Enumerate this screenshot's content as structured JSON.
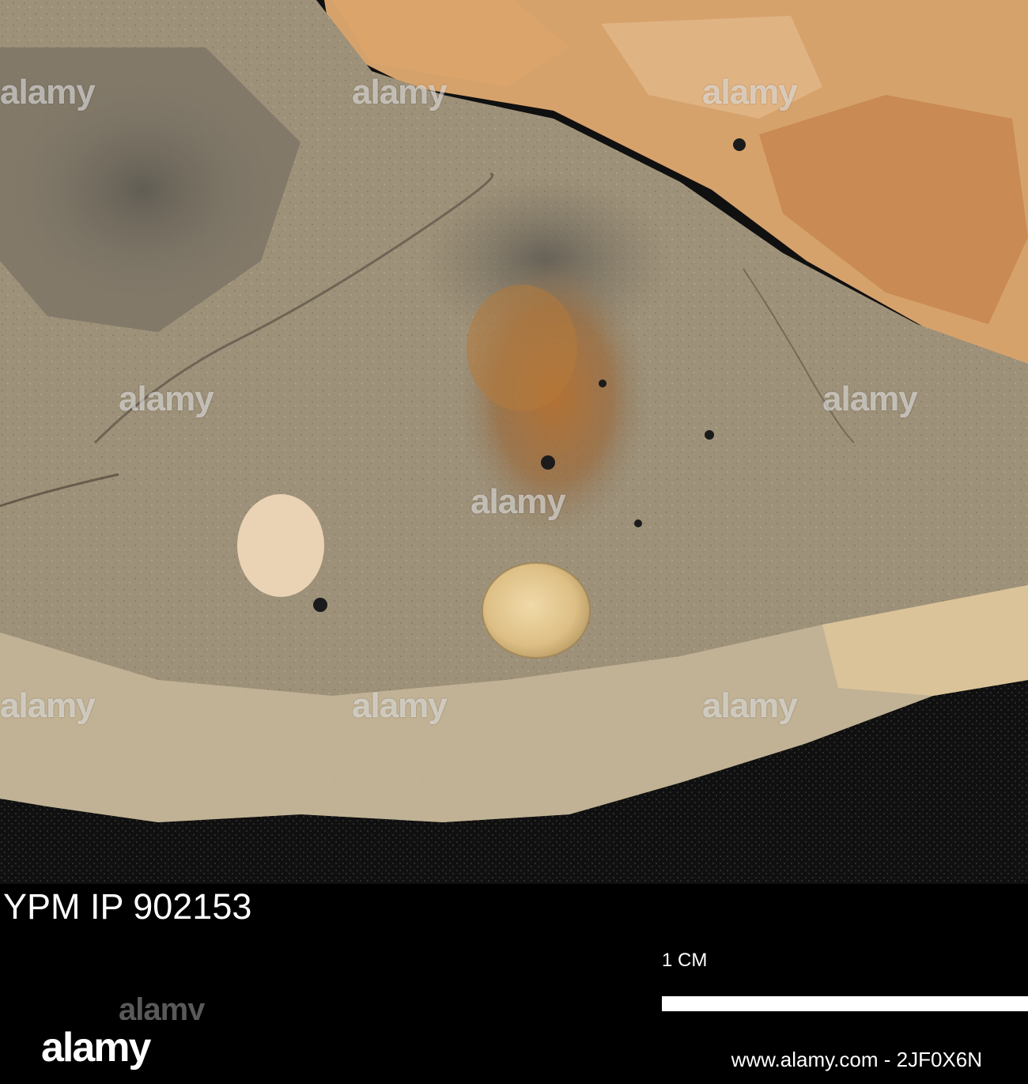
{
  "photo": {
    "subject": "fossil specimen on sediment rock",
    "colors": {
      "rock_gray": "#9c8f78",
      "rock_light": "#b8a98a",
      "orange_clast": "#d9a570",
      "stain_brown": "#a8692d",
      "shell_cream": "#e8cfa0",
      "dark_background": "#0e0e0e"
    }
  },
  "watermark": {
    "text": "alamy"
  },
  "caption": {
    "specimen_id": "YPM IP 902153",
    "scale_label": "1 CM"
  },
  "footer": {
    "logo_text": "alamy",
    "stock_id": "www.alamy.com - 2JF0X6N"
  }
}
